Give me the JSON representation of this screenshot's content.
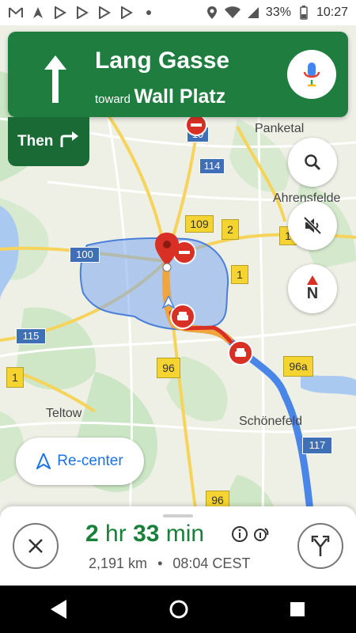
{
  "status_bar": {
    "battery": "33%",
    "time": "10:27"
  },
  "banner": {
    "street": "Lang Gasse",
    "toward_label": "toward",
    "toward_road": "Wall Platz",
    "mic": "mic-icon"
  },
  "then": {
    "label": "Then"
  },
  "map": {
    "places": [
      "Panketal",
      "Ahrensfelde",
      "Teltow",
      "Schönefeld"
    ],
    "road_shields": [
      "10",
      "114",
      "109",
      "2",
      "1",
      "100",
      "1",
      "115",
      "96",
      "96a",
      "117",
      "96",
      "1"
    ]
  },
  "recenter": {
    "label": "Re-center"
  },
  "trip": {
    "hours": "2",
    "hr_label": "hr",
    "minutes": "33",
    "min_label": "min",
    "distance": "2,191 km",
    "separator": "•",
    "arrival": "08:04 CEST"
  },
  "colors": {
    "nav_green": "#1e7d3f",
    "eta_green": "#188038",
    "route_blue": "#4a86e8",
    "accent_blue": "#1a73e8"
  }
}
